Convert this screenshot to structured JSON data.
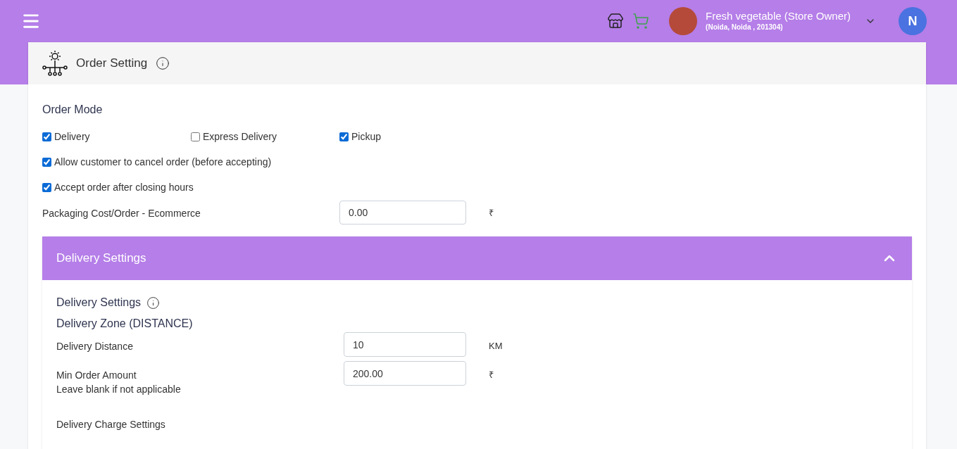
{
  "topbar": {
    "store_name": "Fresh vegetable (Store Owner)",
    "store_address": "(Noida, Noida , 201304)",
    "avatar_letter": "N"
  },
  "card": {
    "title": "Order Setting",
    "order_mode_title": "Order Mode",
    "modes": [
      {
        "label": "Delivery",
        "checked": true
      },
      {
        "label": "Express Delivery",
        "checked": false
      },
      {
        "label": "Pickup",
        "checked": true
      }
    ],
    "options": [
      {
        "label": "Allow customer to cancel order (before accepting)",
        "checked": true
      },
      {
        "label": "Accept order after closing hours",
        "checked": true
      }
    ],
    "packaging": {
      "label": "Packaging Cost/Order - Ecommerce",
      "value": "0.00",
      "unit": "₹"
    }
  },
  "delivery_panel": {
    "title": "Delivery Settings",
    "expanded": true,
    "section_title": "Delivery Settings",
    "zone_title": "Delivery Zone (DISTANCE)",
    "fields": [
      {
        "label": "Delivery Distance",
        "value": "10",
        "unit": "KM"
      },
      {
        "label": "Min Order Amount",
        "hint": "Leave blank if not applicable",
        "value": "200.00",
        "unit": "₹"
      }
    ],
    "charge_title": "Delivery Charge Settings"
  }
}
